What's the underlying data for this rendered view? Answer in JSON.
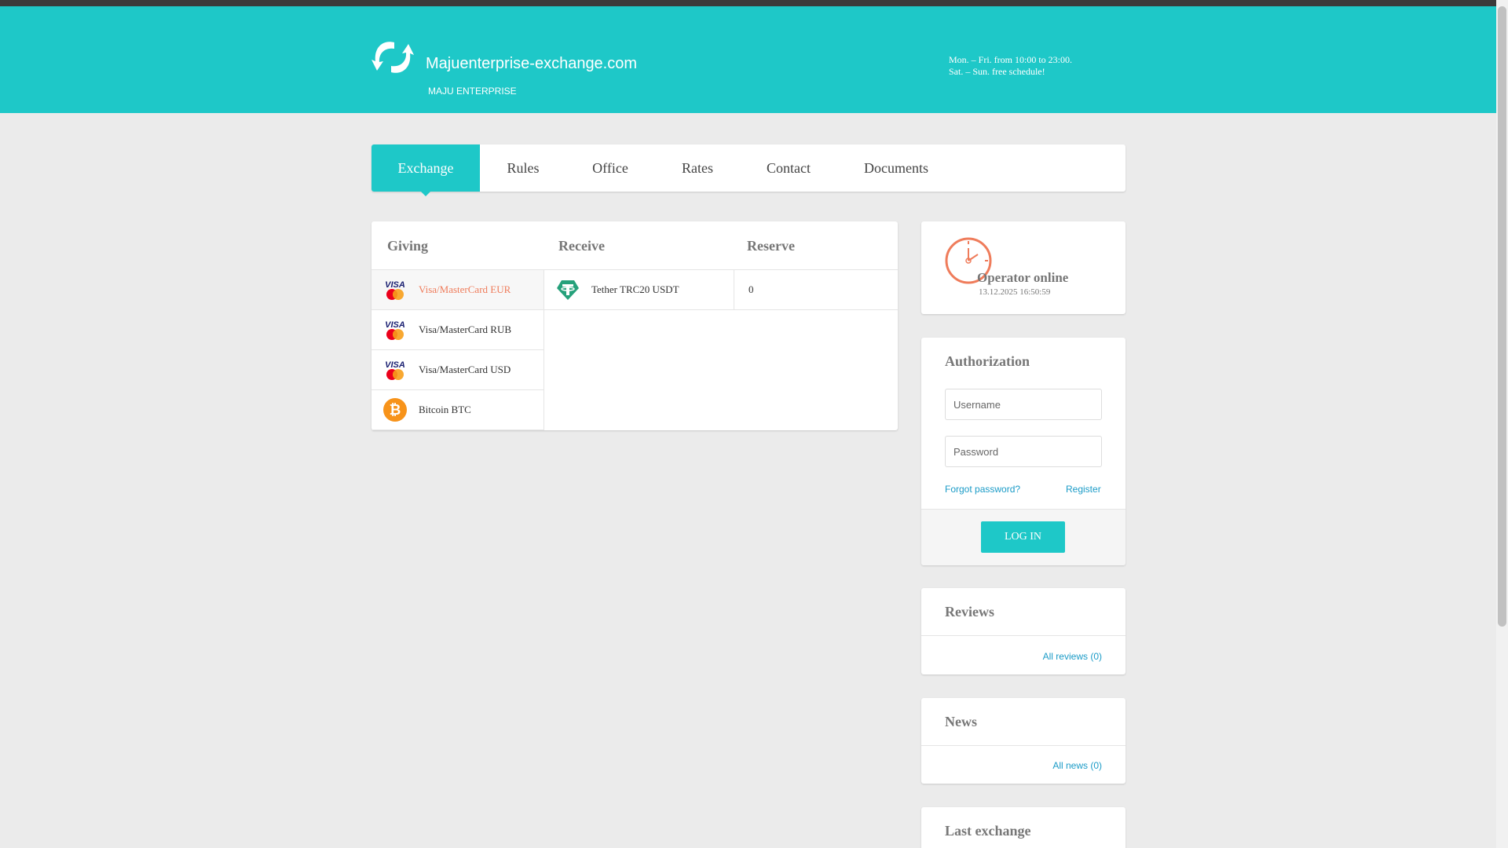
{
  "header": {
    "site_name": "Majuenterprise-exchange.com",
    "site_sub": "MAJU ENTERPRISE",
    "schedule_line1": "Mon. – Fri. from 10:00 to 23:00.",
    "schedule_line2": "Sat. – Sun. free schedule!",
    "accent_color": "#1ec8c8"
  },
  "nav": {
    "items": [
      {
        "label": "Exchange",
        "active": true
      },
      {
        "label": "Rules"
      },
      {
        "label": "Office"
      },
      {
        "label": "Rates"
      },
      {
        "label": "Contact"
      },
      {
        "label": "Documents"
      }
    ]
  },
  "exchange": {
    "giving_header": "Giving",
    "receive_header": "Receive",
    "reserve_header": "Reserve",
    "giving": [
      {
        "label": "Visa/MasterCard EUR",
        "icon": "visa-mastercard-icon",
        "selected": true
      },
      {
        "label": "Visa/MasterCard RUB",
        "icon": "visa-mastercard-icon"
      },
      {
        "label": "Visa/MasterCard USD",
        "icon": "visa-mastercard-icon"
      },
      {
        "label": "Bitcoin BTC",
        "icon": "bitcoin-icon"
      }
    ],
    "receive": [
      {
        "label": "Tether TRC20 USDT",
        "icon": "tether-icon",
        "reserve": "0"
      }
    ]
  },
  "operator": {
    "status": "Operator online",
    "datetime": "13.12.2025 16:50:59",
    "icon": "clock-icon"
  },
  "auth": {
    "title": "Authorization",
    "username_placeholder": "Username",
    "password_placeholder": "Password",
    "forgot": "Forgot password?",
    "register": "Register",
    "login": "LOG IN"
  },
  "reviews": {
    "title": "Reviews",
    "link": "All reviews (0)"
  },
  "news": {
    "title": "News",
    "link": "All news (0)"
  },
  "last_exchange": {
    "title": "Last exchange"
  }
}
